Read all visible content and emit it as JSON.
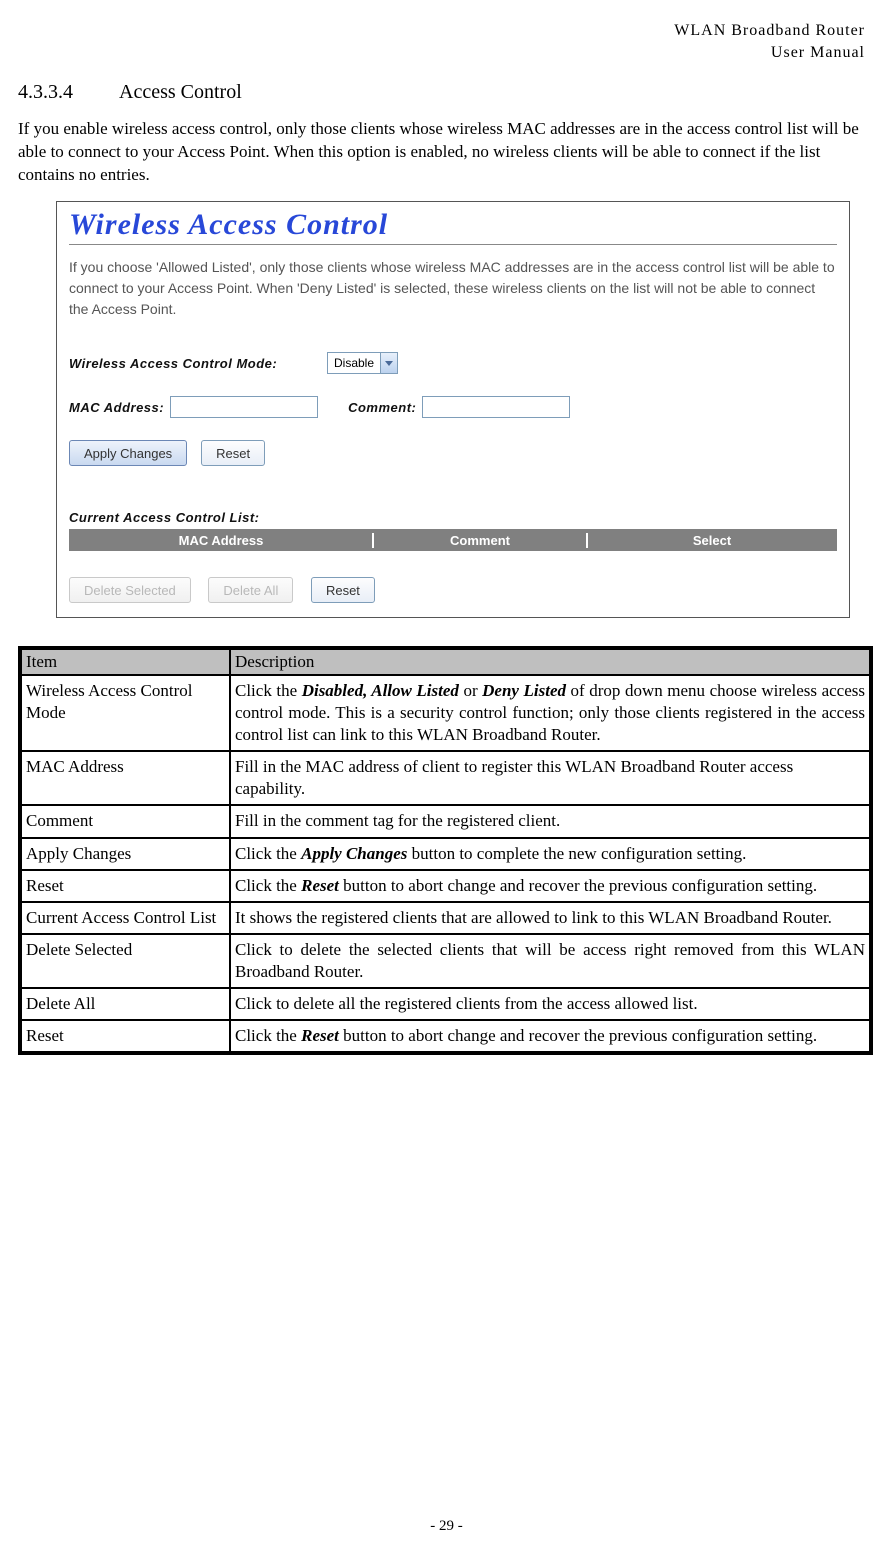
{
  "header": {
    "line1": "WLAN  Broadband  Router",
    "line2": "User  Manual"
  },
  "section": {
    "number": "4.3.3.4",
    "title": "Access Control"
  },
  "intro": "If you enable wireless access control, only those clients whose wireless MAC addresses are in the access control list will be able to connect to your Access Point. When this option is enabled, no wireless clients will be able to connect if the list contains no entries.",
  "shot": {
    "title": "Wireless Access Control",
    "desc": "If you choose 'Allowed Listed', only those clients whose wireless MAC addresses are in the access control list will be able to connect to your Access Point. When 'Deny Listed' is selected, these wireless clients on the list will not be able to connect the Access Point.",
    "mode_label": "Wireless  Access  Control  Mode:",
    "mode_value": "Disable",
    "mac_label": "MAC Address:",
    "comment_label": "Comment:",
    "apply_btn": "Apply Changes",
    "reset_btn": "Reset",
    "cacl_label": "Current  Access  Control  List:",
    "col1": "MAC Address",
    "col2": "Comment",
    "col3": "Select",
    "del_sel_btn": "Delete Selected",
    "del_all_btn": "Delete All",
    "reset2_btn": "Reset"
  },
  "table": {
    "h_item": "Item",
    "h_desc": "Description",
    "rows": [
      {
        "item": "Wireless Access Control Mode",
        "desc_pre": "Click the ",
        "desc_b1": "Disabled",
        "desc_mid1": ", ",
        "desc_b2": "Allow Listed",
        "desc_mid2": " or ",
        "desc_b3": "Deny Listed",
        "desc_post": " of drop down menu choose wireless access control mode. This is a security control function; only those clients registered in the access control list can link to this WLAN Broadband Router."
      },
      {
        "item": "MAC Address",
        "desc": "Fill in the MAC address of client to register this WLAN Broadband Router access capability."
      },
      {
        "item": "Comment",
        "desc": "Fill in the comment tag for the registered client."
      },
      {
        "item": "Apply Changes",
        "desc_pre": "Click the ",
        "desc_b1": "Apply Changes",
        "desc_post": " button to complete the new configuration setting."
      },
      {
        "item": "Reset",
        "desc_pre": "Click the ",
        "desc_b1": "Reset",
        "desc_post": " button to abort change and recover the previous configuration setting."
      },
      {
        "item": "Current Access Control List",
        "desc": "It shows the registered clients that are allowed to link to this WLAN Broadband Router."
      },
      {
        "item": "Delete Selected",
        "desc": "Click to delete the selected clients that will be access right removed from this WLAN Broadband Router."
      },
      {
        "item": "Delete All",
        "desc": "Click to delete all the registered clients from the access allowed list."
      },
      {
        "item": "Reset",
        "desc_pre": "Click the ",
        "desc_b1": "Reset",
        "desc_post": " button to abort change and recover the previous configuration setting."
      }
    ]
  },
  "footer": "- 29 -"
}
